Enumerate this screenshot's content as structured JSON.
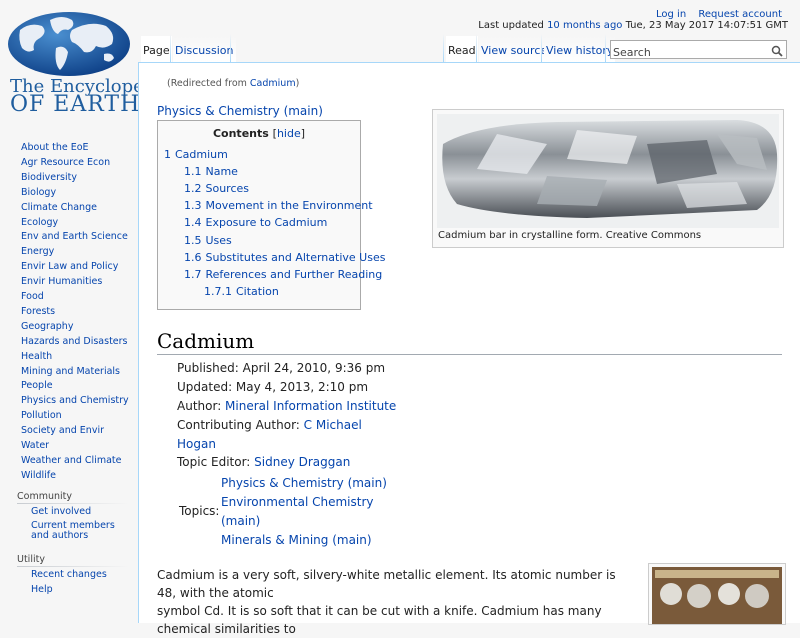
{
  "logo": {
    "line1": "The Encyclopedia",
    "line2": "OF EARTH"
  },
  "personal": {
    "login": "Log in",
    "request": "Request account"
  },
  "last_updated": {
    "prefix": "Last updated",
    "link": "10 months ago",
    "date": "Tue, 23 May 2017 14:07:51 GMT"
  },
  "tabs": {
    "page": "Page",
    "discussion": "Discussion",
    "read": "Read",
    "view_source": "View source",
    "view_history": "View history"
  },
  "search": {
    "placeholder": "Search"
  },
  "sidebar": {
    "items": [
      "About the EoE",
      "Agr Resource Econ",
      "Biodiversity",
      "Biology",
      "Climate Change",
      "Ecology",
      "Env and Earth Science",
      "Energy",
      "Envir Law and Policy",
      "Envir Humanities",
      "Food",
      "Forests",
      "Geography",
      "Hazards and Disasters",
      "Health",
      "Mining and Materials",
      "People",
      "Physics and Chemistry",
      "Pollution",
      "Society and Envir",
      "Water",
      "Weather and Climate",
      "Wildlife"
    ],
    "community": {
      "heading": "Community",
      "items": [
        "Get involved",
        "Current members and authors"
      ]
    },
    "utility": {
      "heading": "Utility",
      "items": [
        "Recent changes",
        "Help"
      ]
    }
  },
  "content": {
    "redirect_prefix": "(Redirected from ",
    "redirect_link": "Cadmium",
    "redirect_suffix": ")",
    "physics_link": "Physics & Chemistry (main)",
    "toc": {
      "title": "Contents",
      "hide_open": "[",
      "hide": "hide",
      "hide_close": "]",
      "items": [
        {
          "num": "1",
          "text": "Cadmium"
        },
        {
          "num": "1.1",
          "text": "Name"
        },
        {
          "num": "1.2",
          "text": "Sources"
        },
        {
          "num": "1.3",
          "text": "Movement in the Environment"
        },
        {
          "num": "1.4",
          "text": "Exposure to Cadmium"
        },
        {
          "num": "1.5",
          "text": "Uses"
        },
        {
          "num": "1.6",
          "text": "Substitutes and Alternative Uses"
        },
        {
          "num": "1.7",
          "text": "References and Further Reading"
        },
        {
          "num": "1.7.1",
          "text": "Citation"
        }
      ]
    },
    "thumb_caption": "Cadmium bar in crystalline form. Creative Commons",
    "heading": "Cadmium",
    "published": "Published: April 24, 2010, 9:36 pm",
    "updated": "Updated: May 4, 2013, 2:10 pm",
    "author_label": "Author: ",
    "author": "Mineral Information Institute",
    "contrib_label": "Contributing Author: ",
    "contrib_1": "C Michael",
    "contrib_2": "Hogan",
    "editor_label": "Topic Editor: ",
    "editor": "Sidney Draggan",
    "topics_label": "Topics:",
    "topics": [
      "Physics & Chemistry (main)",
      "Environmental Chemistry",
      "(main)",
      "Minerals & Mining (main)"
    ],
    "para_line1": "Cadmium is a very soft, silvery-white metallic element. Its atomic number is 48, with the atomic",
    "para_line2": "symbol Cd. It is so soft that it can be cut with a knife. Cadmium has many chemical similarities to"
  }
}
